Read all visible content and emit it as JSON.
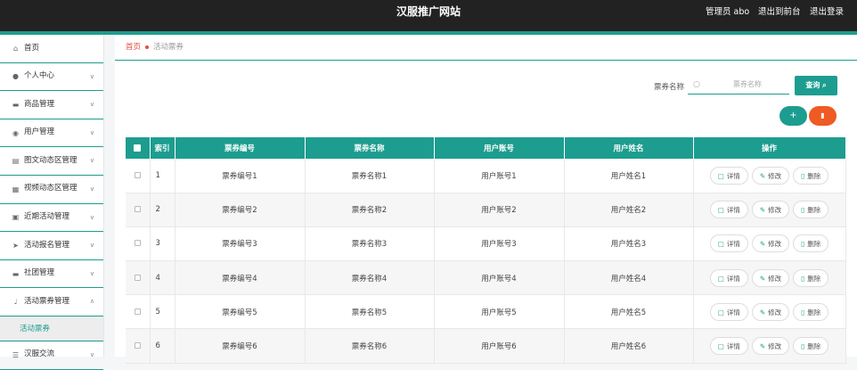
{
  "header": {
    "site_title": "汉服推广网站",
    "admin_label": "管理员 abo",
    "front_link": "退出到前台",
    "logout_link": "退出登录"
  },
  "sidebar": {
    "items": [
      {
        "label": "首页",
        "icon": "home-icon"
      },
      {
        "label": "个人中心",
        "icon": "user-icon"
      },
      {
        "label": "商品管理",
        "icon": "monitor-icon"
      },
      {
        "label": "用户管理",
        "icon": "pin-icon"
      },
      {
        "label": "图文动态区管理",
        "icon": "doc-icon"
      },
      {
        "label": "视频动态区管理",
        "icon": "list-icon"
      },
      {
        "label": "近期活动管理",
        "icon": "calendar-icon"
      },
      {
        "label": "活动报名管理",
        "icon": "send-icon"
      },
      {
        "label": "社团管理",
        "icon": "monitor-icon"
      },
      {
        "label": "活动票券管理",
        "icon": "mic-icon"
      },
      {
        "label": "汉服交流",
        "icon": "menu-icon"
      }
    ],
    "active_sub": "活动票券"
  },
  "breadcrumb": {
    "home": "首页",
    "current": "活动票券"
  },
  "search": {
    "label": "票券名称",
    "placeholder": "票券名称",
    "value": "",
    "button": "查询"
  },
  "actions": {
    "add": "+",
    "delete": "🗑"
  },
  "table": {
    "headers": [
      "索引",
      "票券编号",
      "票券名称",
      "用户账号",
      "用户姓名",
      "操作"
    ],
    "ops": {
      "detail": "详情",
      "edit": "修改",
      "remove": "删除"
    },
    "rows": [
      {
        "idx": "1",
        "code": "票券编号1",
        "name": "票券名称1",
        "account": "用户账号1",
        "username": "用户姓名1"
      },
      {
        "idx": "2",
        "code": "票券编号2",
        "name": "票券名称2",
        "account": "用户账号2",
        "username": "用户姓名2"
      },
      {
        "idx": "3",
        "code": "票券编号3",
        "name": "票券名称3",
        "account": "用户账号3",
        "username": "用户姓名3"
      },
      {
        "idx": "4",
        "code": "票券编号4",
        "name": "票券名称4",
        "account": "用户账号4",
        "username": "用户姓名4"
      },
      {
        "idx": "5",
        "code": "票券编号5",
        "name": "票券名称5",
        "account": "用户账号5",
        "username": "用户姓名5"
      },
      {
        "idx": "6",
        "code": "票券编号6",
        "name": "票券名称6",
        "account": "用户账号6",
        "username": "用户姓名6"
      }
    ]
  },
  "colors": {
    "accent": "#1d9d8f",
    "danger": "#f05a23",
    "topbar": "#222222"
  }
}
